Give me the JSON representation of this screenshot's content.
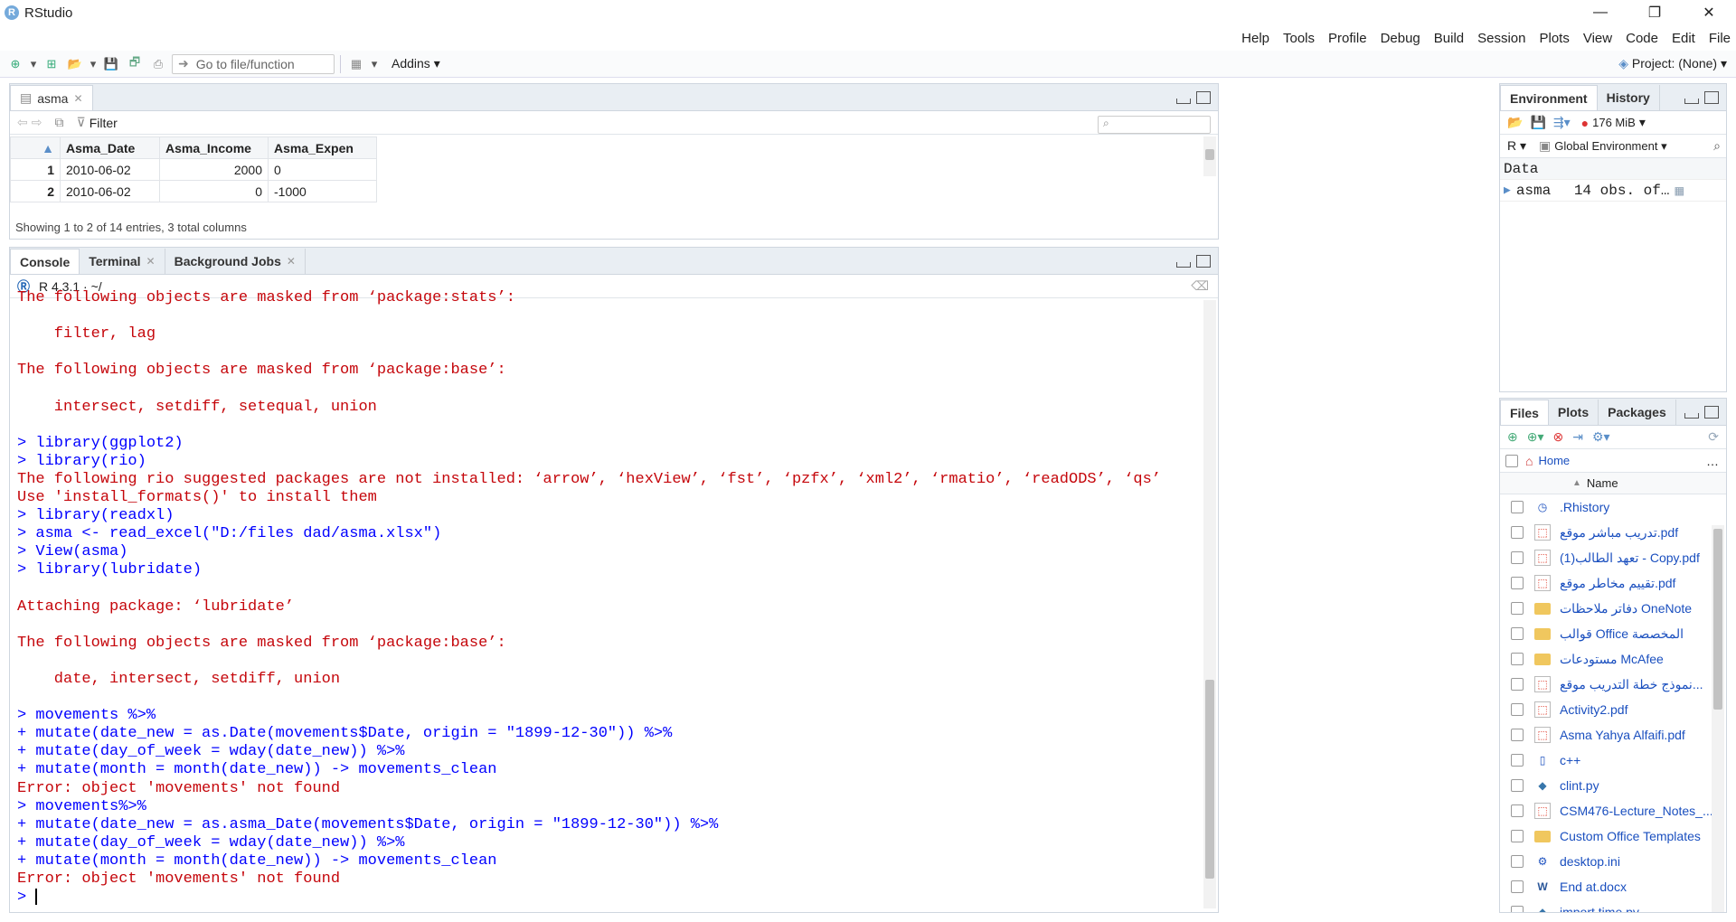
{
  "app": {
    "title": "RStudio",
    "logo_letter": "R"
  },
  "window_controls": [
    "—",
    "❐",
    "✕"
  ],
  "menu": [
    "Help",
    "Tools",
    "Profile",
    "Debug",
    "Build",
    "Session",
    "Plots",
    "View",
    "Code",
    "Edit",
    "File"
  ],
  "toolbar": {
    "goto_placeholder": "Go to file/function",
    "addins": "Addins",
    "project": "Project: (None)"
  },
  "viewer": {
    "tab": "asma",
    "filter": "Filter",
    "columns": [
      "Asma_Date",
      "Asma_Income",
      "Asma_Expen"
    ],
    "rows": [
      {
        "n": "1",
        "date": "2010-06-02",
        "income": "2000",
        "expen": "0"
      },
      {
        "n": "2",
        "date": "2010-06-02",
        "income": "0",
        "expen": "-1000"
      }
    ],
    "status": "Showing 1 to 2 of 14 entries, 3 total columns"
  },
  "console": {
    "tabs": [
      "Console",
      "Terminal",
      "Background Jobs"
    ],
    "version": "R 4.3.1 · ~/",
    "lines": [
      {
        "t": "out",
        "s": "The following objects are masked from ‘package:stats’:"
      },
      {
        "t": "out",
        "s": ""
      },
      {
        "t": "out",
        "s": "    filter, lag"
      },
      {
        "t": "out",
        "s": ""
      },
      {
        "t": "out",
        "s": "The following objects are masked from ‘package:base’:"
      },
      {
        "t": "out",
        "s": ""
      },
      {
        "t": "out",
        "s": "    intersect, setdiff, setequal, union"
      },
      {
        "t": "out",
        "s": ""
      },
      {
        "t": "in",
        "s": "> library(ggplot2)"
      },
      {
        "t": "in",
        "s": "> library(rio)"
      },
      {
        "t": "out",
        "s": "The following rio suggested packages are not installed: ‘arrow’, ‘hexView’, ‘fst’, ‘pzfx’, ‘xml2’, ‘rmatio’, ‘readODS’, ‘qs’"
      },
      {
        "t": "out",
        "s": "Use 'install_formats()' to install them"
      },
      {
        "t": "in",
        "s": "> library(readxl)"
      },
      {
        "t": "in",
        "s": "> asma <- read_excel(\"D:/files dad/asma.xlsx\")"
      },
      {
        "t": "in",
        "s": "> View(asma)"
      },
      {
        "t": "in",
        "s": "> library(lubridate)"
      },
      {
        "t": "out",
        "s": ""
      },
      {
        "t": "out",
        "s": "Attaching package: ‘lubridate’"
      },
      {
        "t": "out",
        "s": ""
      },
      {
        "t": "out",
        "s": "The following objects are masked from ‘package:base’:"
      },
      {
        "t": "out",
        "s": ""
      },
      {
        "t": "out",
        "s": "    date, intersect, setdiff, union"
      },
      {
        "t": "out",
        "s": ""
      },
      {
        "t": "in",
        "s": "> movements %>%"
      },
      {
        "t": "in",
        "s": "+ mutate(date_new = as.Date(movements$Date, origin = \"1899-12-30\")) %>%"
      },
      {
        "t": "in",
        "s": "+ mutate(day_of_week = wday(date_new)) %>%"
      },
      {
        "t": "in",
        "s": "+ mutate(month = month(date_new)) -> movements_clean"
      },
      {
        "t": "err",
        "s": "Error: object 'movements' not found"
      },
      {
        "t": "in",
        "s": "> movements%>%"
      },
      {
        "t": "in",
        "s": "+ mutate(date_new = as.asma_Date(movements$Date, origin = \"1899-12-30\")) %>%"
      },
      {
        "t": "in",
        "s": "+ mutate(day_of_week = wday(date_new)) %>%"
      },
      {
        "t": "in",
        "s": "+ mutate(month = month(date_new)) -> movements_clean"
      },
      {
        "t": "err",
        "s": "Error: object 'movements' not found"
      },
      {
        "t": "in",
        "s": "> "
      }
    ]
  },
  "environment": {
    "tabs": [
      "Environment",
      "History"
    ],
    "memory": "176 MiB",
    "lang": "R",
    "scope": "Global Environment",
    "section": "Data",
    "var_name": "asma",
    "var_value": "14 obs. of…"
  },
  "files": {
    "tabs": [
      "Files",
      "Plots",
      "Packages"
    ],
    "home": "Home",
    "col_name": "Name",
    "more": "…",
    "items": [
      {
        "name": ".Rhistory",
        "type": "hist"
      },
      {
        "name": "تدريب مباشر موقع.pdf",
        "type": "pdf"
      },
      {
        "name": "تعهد الطالب(1) - Copy.pdf",
        "type": "pdf"
      },
      {
        "name": "تقييم مخاطر موقع.pdf",
        "type": "pdf"
      },
      {
        "name": "دفاتر ملاحظات OneNote",
        "type": "folder"
      },
      {
        "name": "قوالب Office المخصصة",
        "type": "folder"
      },
      {
        "name": "مستودعات McAfee",
        "type": "folder"
      },
      {
        "name": "نموذج خطة التدريب موقع...",
        "type": "pdf"
      },
      {
        "name": "Activity2.pdf",
        "type": "pdf"
      },
      {
        "name": "Asma Yahya Alfaifi.pdf",
        "type": "pdf"
      },
      {
        "name": "c++",
        "type": "file"
      },
      {
        "name": "clint.py",
        "type": "py"
      },
      {
        "name": "CSM476-Lecture_Notes_...",
        "type": "pdf"
      },
      {
        "name": "Custom Office Templates",
        "type": "folder"
      },
      {
        "name": "desktop.ini",
        "type": "ini"
      },
      {
        "name": "End at.docx",
        "type": "doc"
      },
      {
        "name": "import time.py",
        "type": "py"
      }
    ]
  }
}
